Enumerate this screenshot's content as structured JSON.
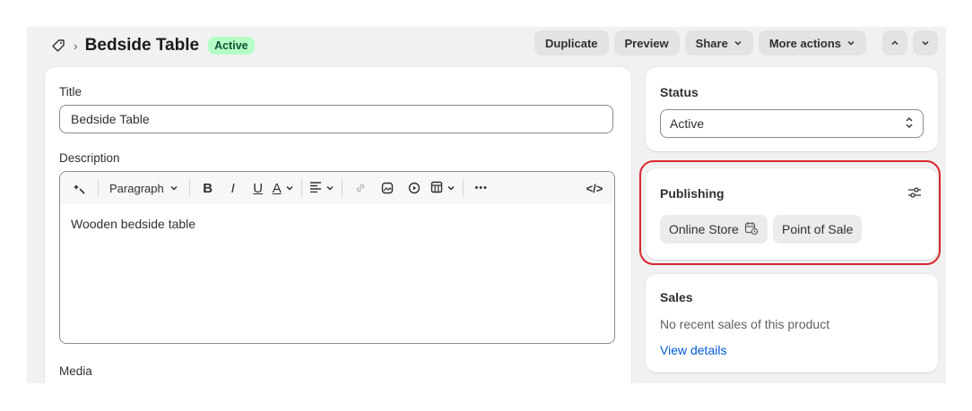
{
  "header": {
    "title": "Bedside Table",
    "status_badge": "Active",
    "buttons": {
      "duplicate": "Duplicate",
      "preview": "Preview",
      "share": "Share",
      "more_actions": "More actions"
    }
  },
  "main": {
    "title_label": "Title",
    "title_value": "Bedside Table",
    "description_label": "Description",
    "toolbar": {
      "paragraph": "Paragraph",
      "bold": "B",
      "italic": "I",
      "underline": "U",
      "color": "A",
      "more": "•••",
      "code": "</>"
    },
    "description_value": "Wooden bedside table",
    "media_label": "Media"
  },
  "status_card": {
    "title": "Status",
    "value": "Active"
  },
  "publishing_card": {
    "title": "Publishing",
    "channels": [
      "Online Store",
      "Point of Sale"
    ]
  },
  "sales_card": {
    "title": "Sales",
    "text": "No recent sales of this product",
    "link": "View details"
  },
  "colors": {
    "accent_link": "#005bd3",
    "badge_bg": "#b4fec6",
    "highlight": "#d9262e"
  }
}
